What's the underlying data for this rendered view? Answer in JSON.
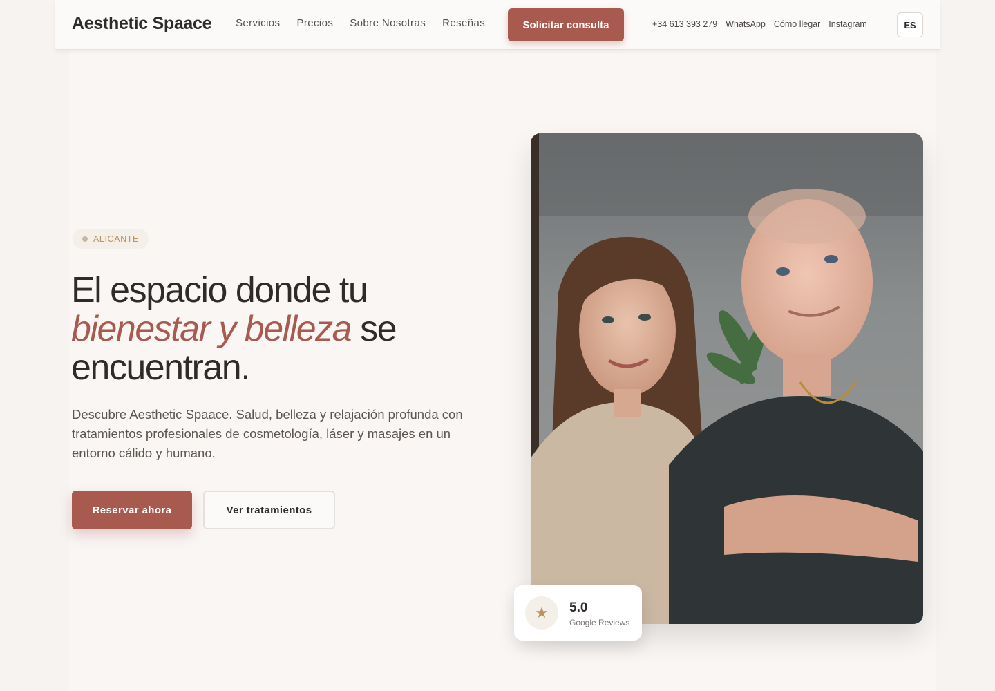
{
  "header": {
    "logo": "Aesthetic Spaace",
    "nav": [
      "Servicios",
      "Precios",
      "Sobre Nosotras",
      "Reseñas"
    ],
    "cta": "Solicitar consulta",
    "contacts": {
      "phone": "+34 613 393 279",
      "whatsapp": "WhatsApp",
      "directions": "Cómo llegar",
      "instagram": "Instagram"
    },
    "language": "ES"
  },
  "hero": {
    "badge": "ALICANTE",
    "headline": {
      "part1": "El espacio donde tu",
      "highlight": "bienestar y belleza",
      "part2": "se",
      "part3": "encuentran."
    },
    "description": "Descubre Aesthetic Spaace. Salud, belleza y relajación profunda con tratamientos profesionales de cosmetología, láser y masajes en un entorno cálido y humano.",
    "primary_button": "Reservar ahora",
    "secondary_button": "Ver tratamientos"
  },
  "rating_card": {
    "icon": "star-icon",
    "score": "5.0",
    "source": "Google Reviews"
  },
  "colors": {
    "accent": "#a85a4f",
    "gold": "#b8945f",
    "background": "#f6f3f1",
    "text": "#2e2b2a"
  }
}
